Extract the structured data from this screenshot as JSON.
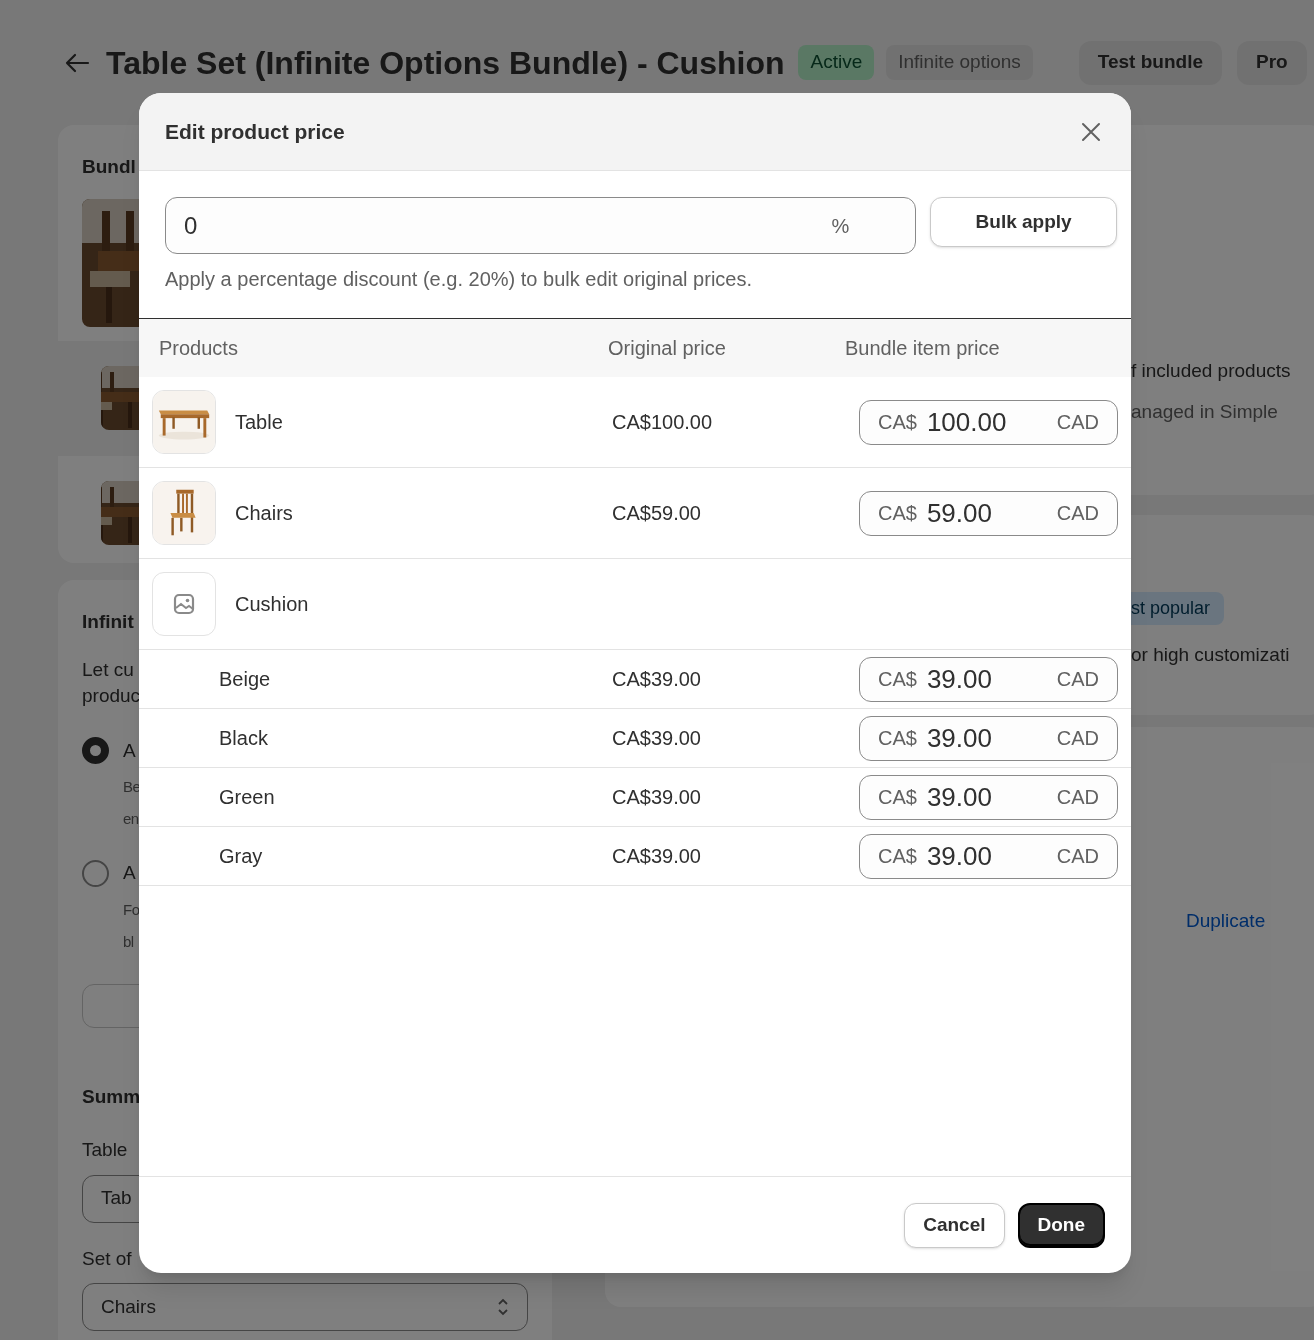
{
  "page": {
    "title": "Table Set (Infinite Options Bundle) - Cushion",
    "badges": [
      {
        "label": "Active",
        "kind": "success"
      },
      {
        "label": "Infinite options",
        "kind": "neutral"
      }
    ],
    "header_buttons": [
      "Test bundle",
      "Pro"
    ],
    "bundle_card": {
      "heading": "Bundl"
    },
    "options_card": {
      "heading": "Infinit",
      "description": [
        "Let cu",
        "produc"
      ],
      "radios": [
        {
          "label": "A",
          "description": [
            "Be",
            "en"
          ],
          "selected": true
        },
        {
          "label": "A",
          "description": [
            "Fo",
            "bl"
          ],
          "selected": false
        }
      ]
    },
    "summary": {
      "heading": "Summ",
      "fields": [
        {
          "label": "Table",
          "value": "Tab",
          "kind": "text"
        },
        {
          "label": "Set of",
          "value": "Chairs",
          "kind": "select"
        }
      ]
    },
    "right": {
      "lines": [
        "f included products",
        "anaged in Simple"
      ],
      "badge": "st popular",
      "note": "or high customizati",
      "link": "Duplicate"
    }
  },
  "modal": {
    "title": "Edit product price",
    "discount": {
      "value": "0",
      "suffix": "%"
    },
    "bulk_button": "Bulk apply",
    "help": "Apply a percentage discount (e.g. 20%) to bulk edit original prices.",
    "columns": [
      "Products",
      "Original price",
      "Bundle item price"
    ],
    "products": [
      {
        "name": "Table",
        "original_price": "CA$100.00",
        "bundle_price": {
          "prefix": "CA$",
          "value": "100.00",
          "suffix": "CAD"
        }
      },
      {
        "name": "Chairs",
        "original_price": "CA$59.00",
        "bundle_price": {
          "prefix": "CA$",
          "value": "59.00",
          "suffix": "CAD"
        }
      },
      {
        "name": "Cushion",
        "thumbnail": {
          "kind": "placeholder"
        },
        "children": [
          {
            "name": "Beige",
            "original_price": "CA$39.00",
            "bundle_price": {
              "prefix": "CA$",
              "value": "39.00",
              "suffix": "CAD"
            }
          },
          {
            "name": "Black",
            "original_price": "CA$39.00",
            "bundle_price": {
              "prefix": "CA$",
              "value": "39.00",
              "suffix": "CAD"
            }
          },
          {
            "name": "Green",
            "original_price": "CA$39.00",
            "bundle_price": {
              "prefix": "CA$",
              "value": "39.00",
              "suffix": "CAD"
            }
          },
          {
            "name": "Gray",
            "original_price": "CA$39.00",
            "bundle_price": {
              "prefix": "CA$",
              "value": "39.00",
              "suffix": "CAD"
            }
          }
        ]
      }
    ],
    "footer_buttons": [
      {
        "label": "Cancel",
        "kind": "secondary"
      },
      {
        "label": "Done",
        "kind": "primary"
      }
    ]
  }
}
